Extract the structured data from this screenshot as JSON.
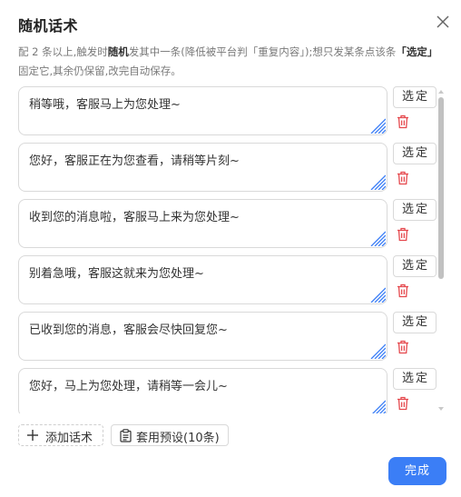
{
  "dialog": {
    "title": "随机话术",
    "close_icon": "close-icon",
    "description": {
      "p1": "配 2 条以上,触发时",
      "p2": "随机",
      "p3": "发其中一条(降低被平台判「重复内容」);想只发某条点该条",
      "p4": "「选定」",
      "p5": "固定它,其余仍保留,改完自动保存。"
    }
  },
  "phrases": [
    {
      "text": "稍等哦，客服马上为您处理~",
      "select_label": "选定"
    },
    {
      "text": "您好，客服正在为您查看，请稍等片刻~",
      "select_label": "选定"
    },
    {
      "text": "收到您的消息啦，客服马上来为您处理~",
      "select_label": "选定"
    },
    {
      "text": "别着急哦，客服这就来为您处理~",
      "select_label": "选定"
    },
    {
      "text": "已收到您的消息，客服会尽快回复您~",
      "select_label": "选定"
    },
    {
      "text": "您好，马上为您处理，请稍等一会儿~",
      "select_label": "选定"
    }
  ],
  "footer": {
    "add_label": "添加话术",
    "preset_label": "套用预设(10条)",
    "done_label": "完成"
  },
  "colors": {
    "primary": "#3b7ef6",
    "danger": "#e5484d",
    "border": "#d9d9d9",
    "resize_handle": "#3b7ef6"
  },
  "icons": {
    "add": "plus-icon",
    "preset": "clipboard-icon",
    "delete": "trash-icon",
    "resize": "resize-handle-icon"
  }
}
